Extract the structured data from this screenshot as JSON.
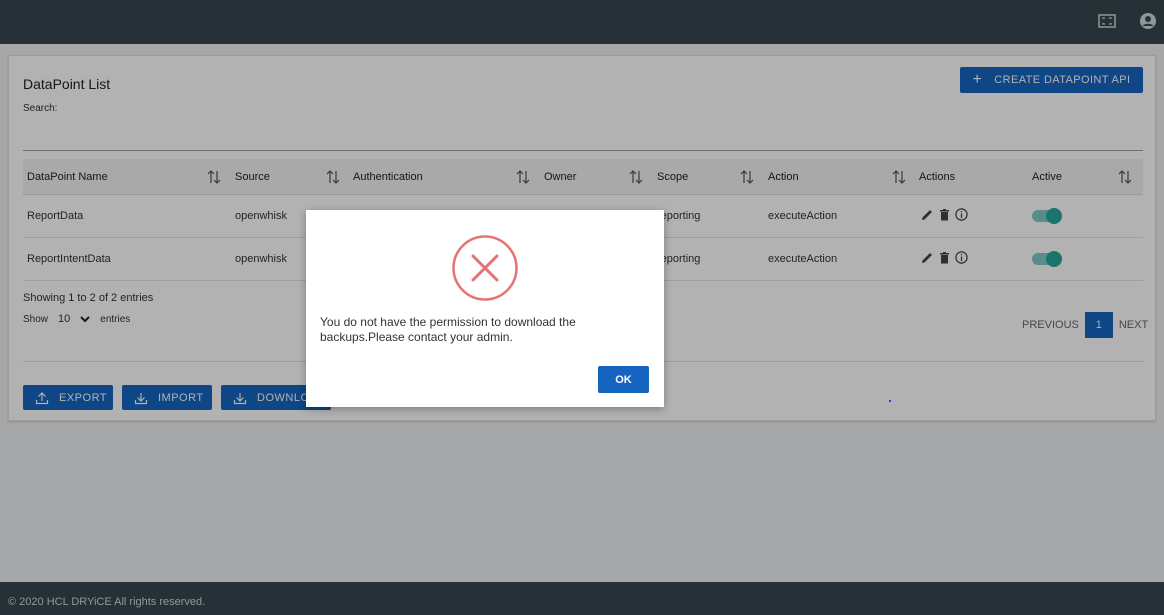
{
  "page": {
    "title": "DataPoint List",
    "search_label": "Search:",
    "create_button": "CREATE DATAPOINT API"
  },
  "table": {
    "columns": [
      "DataPoint Name",
      "Source",
      "Authentication",
      "Owner",
      "Scope",
      "Action",
      "Actions",
      "Active"
    ],
    "rows": [
      {
        "name": "ReportData",
        "source": "openwhisk",
        "authentication": "",
        "owner": "",
        "scope": "reporting",
        "action": "executeAction",
        "active": true
      },
      {
        "name": "ReportIntentData",
        "source": "openwhisk",
        "authentication": "",
        "owner": "",
        "scope": "reporting",
        "action": "executeAction",
        "active": true
      }
    ]
  },
  "entries_info": "Showing 1 to 2 of 2 entries",
  "show": {
    "label": "Show",
    "value": "10",
    "suffix": "entries"
  },
  "pager": {
    "previous": "PREVIOUS",
    "current": "1",
    "next": "NEXT"
  },
  "buttons": {
    "export": "EXPORT",
    "import": "IMPORT",
    "download": "DOWNLOAD"
  },
  "footer": "© 2020 HCL DRYiCE All rights reserved.",
  "modal": {
    "message": "You do not have the permission to download the backups.Please contact your admin.",
    "ok": "OK",
    "icon": "error-x-circle-icon"
  },
  "colors": {
    "header": "#37474f",
    "primary": "#1565c0",
    "toggle": "#26a69a",
    "error": "#e57373"
  }
}
